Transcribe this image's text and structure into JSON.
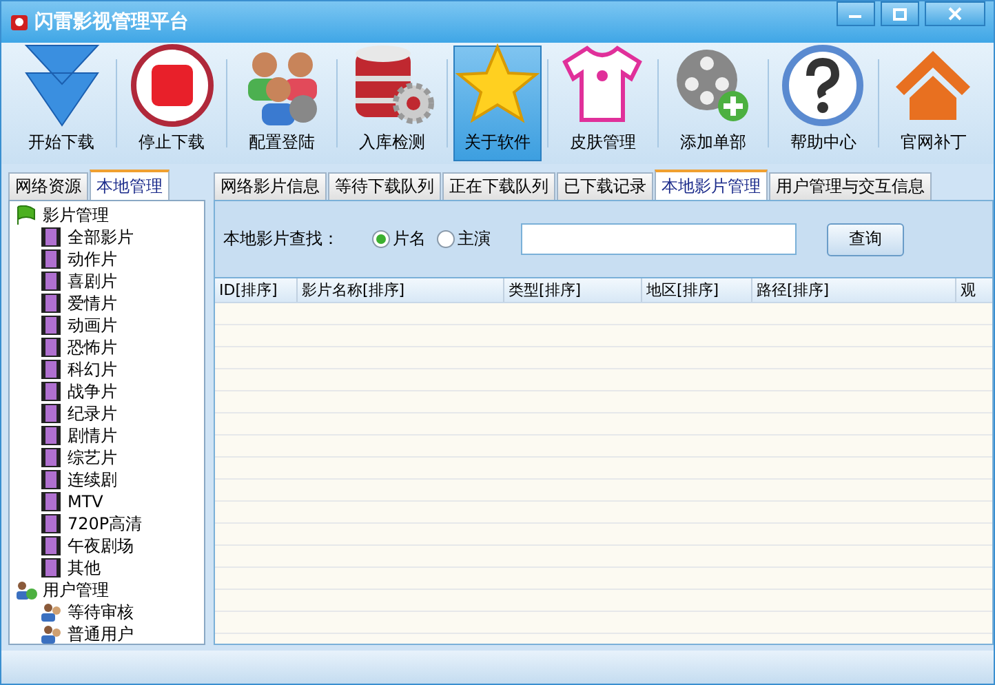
{
  "window": {
    "title": "闪雷影视管理平台"
  },
  "toolbar": [
    {
      "label": "开始下载",
      "kind": "download",
      "selected": false
    },
    {
      "label": "停止下载",
      "kind": "stop",
      "selected": false
    },
    {
      "label": "配置登陆",
      "kind": "users",
      "selected": false
    },
    {
      "label": "入库检测",
      "kind": "database",
      "selected": false
    },
    {
      "label": "关于软件",
      "kind": "star",
      "selected": true
    },
    {
      "label": "皮肤管理",
      "kind": "shirt",
      "selected": false
    },
    {
      "label": "添加单部",
      "kind": "reel",
      "selected": false
    },
    {
      "label": "帮助中心",
      "kind": "help",
      "selected": false
    },
    {
      "label": "官网补丁",
      "kind": "home",
      "selected": false
    }
  ],
  "sidebar": {
    "tabs": [
      {
        "label": "网络资源",
        "selected": false
      },
      {
        "label": "本地管理",
        "selected": true
      }
    ],
    "tree": [
      {
        "label": "影片管理",
        "kind": "flag",
        "children": [
          {
            "label": "全部影片",
            "kind": "film"
          },
          {
            "label": "动作片",
            "kind": "film"
          },
          {
            "label": "喜剧片",
            "kind": "film"
          },
          {
            "label": "爱情片",
            "kind": "film"
          },
          {
            "label": "动画片",
            "kind": "film"
          },
          {
            "label": "恐怖片",
            "kind": "film"
          },
          {
            "label": "科幻片",
            "kind": "film"
          },
          {
            "label": "战争片",
            "kind": "film"
          },
          {
            "label": "纪录片",
            "kind": "film"
          },
          {
            "label": "剧情片",
            "kind": "film"
          },
          {
            "label": "综艺片",
            "kind": "film"
          },
          {
            "label": "连续剧",
            "kind": "film"
          },
          {
            "label": "MTV",
            "kind": "film"
          },
          {
            "label": "720P高清",
            "kind": "film"
          },
          {
            "label": "午夜剧场",
            "kind": "film"
          },
          {
            "label": "其他",
            "kind": "film"
          }
        ]
      },
      {
        "label": "用户管理",
        "kind": "users",
        "children": [
          {
            "label": "等待审核",
            "kind": "user"
          },
          {
            "label": "普通用户",
            "kind": "user"
          }
        ]
      }
    ]
  },
  "tabs": [
    {
      "label": "网络影片信息",
      "selected": false
    },
    {
      "label": "等待下载队列",
      "selected": false
    },
    {
      "label": "正在下载队列",
      "selected": false
    },
    {
      "label": "已下载记录",
      "selected": false
    },
    {
      "label": "本地影片管理",
      "selected": true
    },
    {
      "label": "用户管理与交互信息",
      "selected": false
    }
  ],
  "search": {
    "label": "本地影片查找：",
    "options": [
      {
        "label": "片名",
        "selected": true
      },
      {
        "label": "主演",
        "selected": false
      }
    ],
    "button": "查询"
  },
  "table": {
    "columns": [
      "ID[排序]",
      "影片名称[排序]",
      "类型[排序]",
      "地区[排序]",
      "路径[排序]",
      "观"
    ]
  }
}
